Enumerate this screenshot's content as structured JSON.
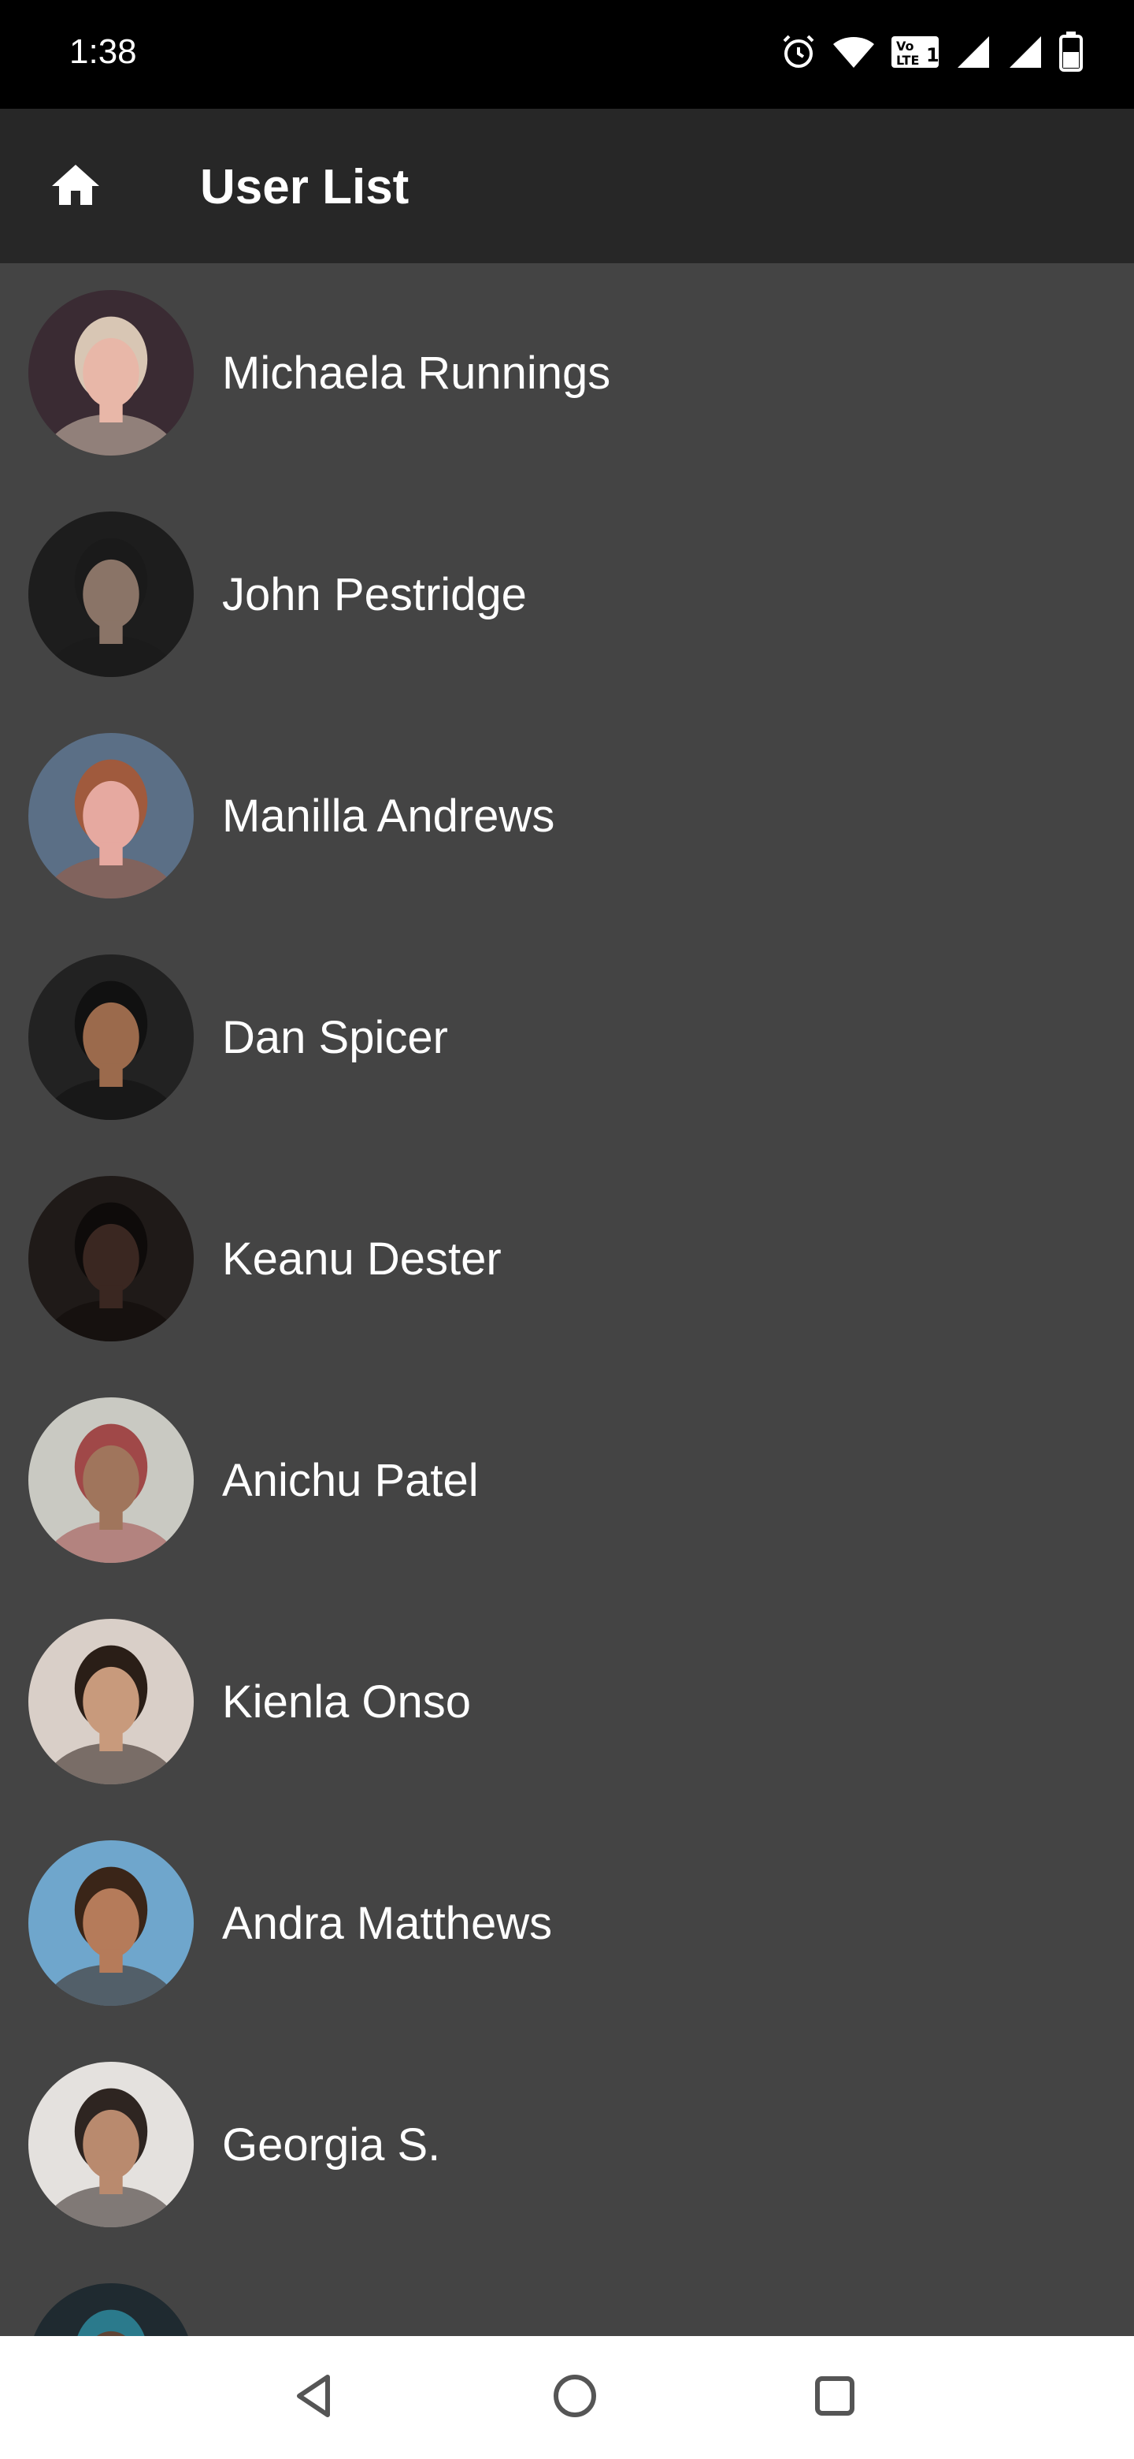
{
  "status_bar": {
    "time": "1:38",
    "icons": [
      "alarm-icon",
      "wifi-icon",
      "volte-icon",
      "signal-icon",
      "signal-icon-2",
      "battery-icon"
    ]
  },
  "app_bar": {
    "title": "User List",
    "home_icon": "home-icon"
  },
  "users": [
    {
      "name": "Michaela Runnings",
      "avatar_bg": "#3a2b33",
      "skin": "#e8b7a8",
      "hair": "#d8c6b4"
    },
    {
      "name": "John Pestridge",
      "avatar_bg": "#1d1d1d",
      "skin": "#8a7467",
      "hair": "#1a1a1a"
    },
    {
      "name": "Manilla Andrews",
      "avatar_bg": "#5b6f86",
      "skin": "#e6a9a0",
      "hair": "#a05a3d"
    },
    {
      "name": "Dan Spicer",
      "avatar_bg": "#222222",
      "skin": "#9b6a4c",
      "hair": "#111111"
    },
    {
      "name": "Keanu Dester",
      "avatar_bg": "#1f1a18",
      "skin": "#3a2721",
      "hair": "#0e0b0a"
    },
    {
      "name": "Anichu Patel",
      "avatar_bg": "#c9c9c2",
      "skin": "#a0755c",
      "hair": "#a04848"
    },
    {
      "name": "Kienla Onso",
      "avatar_bg": "#d9cfc8",
      "skin": "#c89a7c",
      "hair": "#2a1e17"
    },
    {
      "name": "Andra Matthews",
      "avatar_bg": "#6fa6cc",
      "skin": "#b57b5a",
      "hair": "#3a2518"
    },
    {
      "name": "Georgia S.",
      "avatar_bg": "#e4e1de",
      "skin": "#b98a6e",
      "hair": "#2e2521"
    },
    {
      "name": "",
      "avatar_bg": "#1f2a30",
      "skin": "#5f4435",
      "hair": "#2b7a8c"
    }
  ],
  "nav_bar": {
    "back_icon": "back-triangle-icon",
    "home_icon": "home-circle-icon",
    "recents_icon": "recents-square-icon"
  }
}
